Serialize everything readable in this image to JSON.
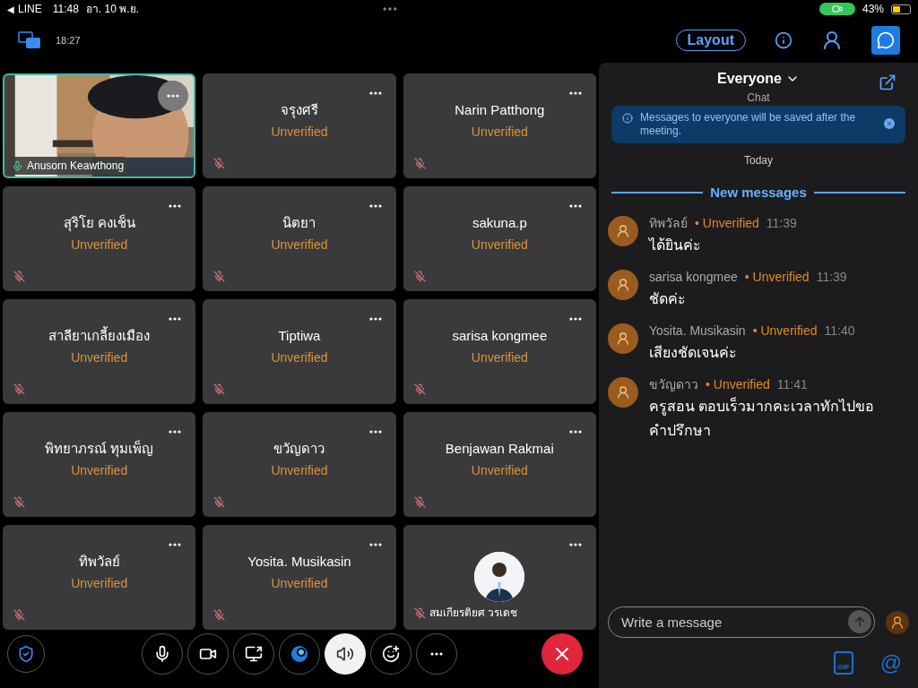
{
  "status_bar": {
    "back": "◀",
    "app": "LINE",
    "time": "11:48",
    "date": "อา. 10 พ.ย.",
    "battery": "43%"
  },
  "top_bar": {
    "duration": "18:27",
    "layout_button": "Layout",
    "chat_selected": true
  },
  "tiles": [
    {
      "kind": "video",
      "name": "Anusorn Keawthong",
      "muted": false,
      "speaking": true
    },
    {
      "kind": "name",
      "name": "จรุงศรี",
      "status": "Unverified",
      "muted": true,
      "speaking": false
    },
    {
      "kind": "name",
      "name": "Narin Patthong",
      "status": "Unverified",
      "muted": true,
      "speaking": false
    },
    {
      "kind": "name",
      "name": "สุริโย คงเช็น",
      "status": "Unverified",
      "muted": true,
      "speaking": false
    },
    {
      "kind": "name",
      "name": "นิตยา",
      "status": "Unverified",
      "muted": true,
      "speaking": false
    },
    {
      "kind": "name",
      "name": "sakuna.p",
      "status": "Unverified",
      "muted": true,
      "speaking": false
    },
    {
      "kind": "name",
      "name": "สาลียาเกลี้ยงเมือง",
      "status": "Unverified",
      "muted": true,
      "speaking": false
    },
    {
      "kind": "name",
      "name": "Tiptiwa",
      "status": "Unverified",
      "muted": true,
      "speaking": false
    },
    {
      "kind": "name",
      "name": "sarisa kongmee",
      "status": "Unverified",
      "muted": true,
      "speaking": false
    },
    {
      "kind": "name",
      "name": "พิทยาภรณ์ ทุมเพ็ญ",
      "status": "Unverified",
      "muted": true,
      "speaking": false
    },
    {
      "kind": "name",
      "name": "ขวัญดาว",
      "status": "Unverified",
      "muted": true,
      "speaking": false
    },
    {
      "kind": "name",
      "name": "Benjawan Rakmai",
      "status": "Unverified",
      "muted": true,
      "speaking": false
    },
    {
      "kind": "name",
      "name": "ทิพวัลย์",
      "status": "Unverified",
      "muted": true,
      "speaking": false
    },
    {
      "kind": "name",
      "name": "Yosita. Musikasin",
      "status": "Unverified",
      "muted": true,
      "speaking": false
    },
    {
      "kind": "avatar",
      "name": "สมเกียรติยศ วรเดช",
      "muted": true,
      "speaking": false
    }
  ],
  "controls": [
    {
      "kind": "mic",
      "on": false
    },
    {
      "kind": "camera",
      "on": false
    },
    {
      "kind": "share",
      "on": false
    },
    {
      "kind": "assistant",
      "on": false
    },
    {
      "kind": "speaker",
      "on": true
    },
    {
      "kind": "reactions",
      "on": false
    },
    {
      "kind": "more",
      "on": false
    }
  ],
  "chat": {
    "title": "Everyone",
    "subtitle": "Chat",
    "notice": "Messages to everyone will be saved after the meeting.",
    "day": "Today",
    "divider": "New messages",
    "messages": [
      {
        "sender": "ทิพวัลย์",
        "status": "• Unverified",
        "time": "11:39",
        "text": "ได้ยินค่ะ"
      },
      {
        "sender": "sarisa kongmee",
        "status": "• Unverified",
        "time": "11:39",
        "text": "ชัดค่ะ"
      },
      {
        "sender": "Yosita. Musikasin",
        "status": "• Unverified",
        "time": "11:40",
        "text": "เสียงชัดเจนค่ะ"
      },
      {
        "sender": "ขวัญดาว",
        "status": "• Unverified",
        "time": "11:41",
        "text": "ครูสอน ตอบเร็วมากคะเวลาทักไปขอคำปรึกษา"
      }
    ],
    "input": {
      "placeholder": "Write a message"
    },
    "gif": "GIF",
    "mention": "@"
  }
}
